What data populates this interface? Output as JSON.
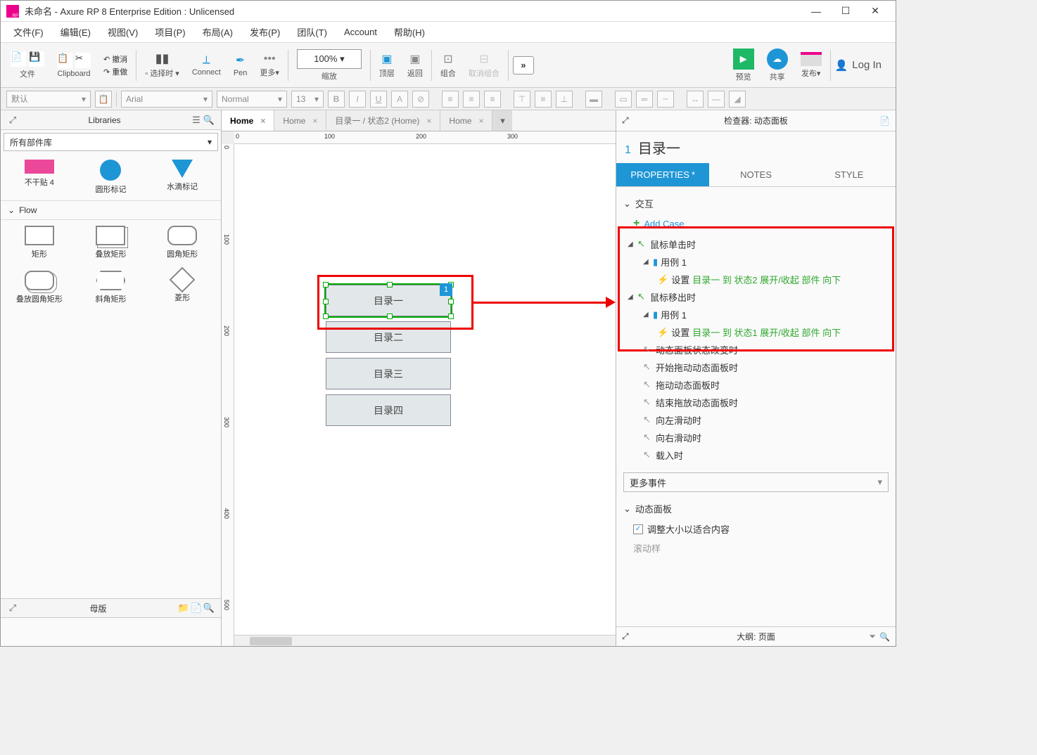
{
  "title": "未命名 - Axure RP 8 Enterprise Edition : Unlicensed",
  "menu": [
    "文件(F)",
    "编辑(E)",
    "视图(V)",
    "项目(P)",
    "布局(A)",
    "发布(P)",
    "团队(T)",
    "Account",
    "帮助(H)"
  ],
  "toolbar": {
    "file": "文件",
    "clipboard": "Clipboard",
    "undo": "撤消",
    "redo": "重做",
    "selecttime": "选择时",
    "connect": "Connect",
    "pen": "Pen",
    "more": "更多▾",
    "zoom": "100%",
    "zoom_label": "缩放",
    "front": "顶层",
    "back": "返回",
    "group": "组合",
    "ungroup": "取消组合",
    "preview": "预览",
    "share": "共享",
    "publish": "发布▾",
    "login": "Log In"
  },
  "format": {
    "style": "默认",
    "font": "Arial",
    "weight": "Normal",
    "size": "13"
  },
  "left": {
    "libraries": "Libraries",
    "allwidgets": "所有部件库",
    "row1": [
      "不干贴 4",
      "圆形标记",
      "水滴标记"
    ],
    "flow": "Flow",
    "row2": [
      "矩形",
      "叠放矩形",
      "圆角矩形"
    ],
    "row3": [
      "叠放圆角矩形",
      "斜角矩形",
      "菱形"
    ],
    "masters": "母版"
  },
  "tabs": [
    {
      "label": "Home",
      "active": true
    },
    {
      "label": "Home",
      "active": false
    },
    {
      "label": "目录一 / 状态2 (Home)",
      "active": false
    },
    {
      "label": "Home",
      "active": false
    }
  ],
  "ruler_h": [
    "0",
    "100",
    "200",
    "300"
  ],
  "ruler_v": [
    "0",
    "100",
    "200",
    "300",
    "400",
    "500"
  ],
  "widgets": [
    "目录一",
    "目录二",
    "目录三",
    "目录四"
  ],
  "sel_badge": "1",
  "inspector": {
    "title": "检查器: 动态面板",
    "num": "1",
    "name": "目录一",
    "tabs": [
      "PROPERTIES",
      "NOTES",
      "STYLE"
    ],
    "interaction": "交互",
    "addcase": "Add Case",
    "events": {
      "click": "鼠标单击时",
      "case1": "用例 1",
      "act1_prefix": "设置 ",
      "act1_target": "目录一 到 状态2 展开/收起 部件 向下",
      "mouseout": "鼠标移出时",
      "case2": "用例 1",
      "act2_prefix": "设置 ",
      "act2_target": "目录一 到 状态1 展开/收起 部件 向下",
      "other": [
        "动态面板状态改变时",
        "开始拖动动态面板时",
        "拖动动态面板时",
        "结束拖放动态面板时",
        "向左滑动时",
        "向右滑动时",
        "载入时"
      ]
    },
    "moreevents": "更多事件",
    "dp_section": "动态面板",
    "fitcontent": "调整大小以适合内容",
    "scroll": "滚动样",
    "outline": "大纲: 页面"
  }
}
